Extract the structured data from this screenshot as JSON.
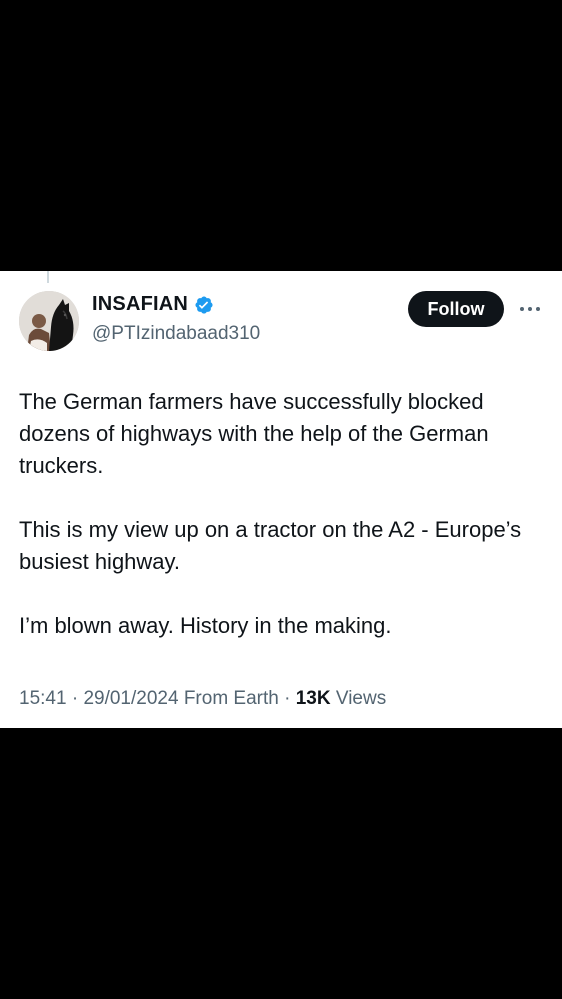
{
  "tweet": {
    "author": {
      "display_name": "INSAFIAN",
      "handle": "@PTIzindabaad310",
      "verified": true,
      "verified_color": "#1d9bf0"
    },
    "follow_label": "Follow",
    "paragraphs": [
      "The German farmers have successfully blocked dozens of highways with the help of the German truckers.",
      "This is my view up on a tractor on the A2 - Europe’s busiest highway.",
      "I’m blown away. History in the making."
    ],
    "time": "15:41",
    "date": "29/01/2024",
    "source": "From Earth",
    "views_count": "13K",
    "views_label": "Views"
  },
  "icons": {
    "verified": "verified-badge-icon",
    "more": "more-horizontal-icon",
    "avatar": "horse-avatar"
  }
}
